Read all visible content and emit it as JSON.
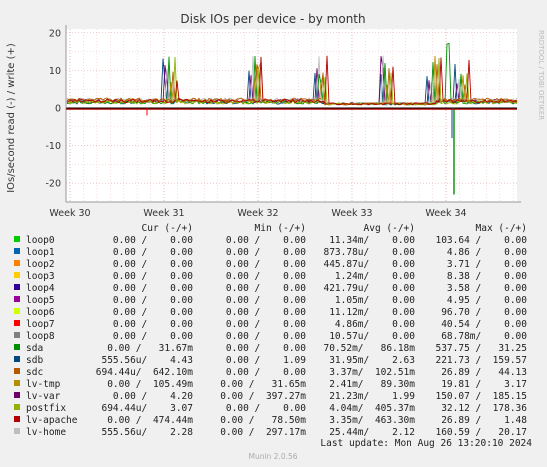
{
  "chart_data": {
    "type": "line",
    "title": "Disk IOs per device - by month",
    "ylabel": "IOs/second read (-) / write (+)",
    "side_label": "RRDTOOL / TOBI OETIKER",
    "ylim": [
      -25,
      21
    ],
    "yticks": [
      20,
      10,
      0,
      -10,
      -20
    ],
    "x_ticks": [
      "Week 30",
      "Week 31",
      "Week 32",
      "Week 33",
      "Week 34"
    ],
    "grid": true,
    "legend": {
      "headers": [
        "Cur (-/+)",
        "Min (-/+)",
        "Avg (-/+)",
        "Max (-/+)"
      ],
      "rows": [
        {
          "name": "loop0",
          "color": "#00cc00",
          "cur": "0.00 /    0.00",
          "min": "0.00 /    0.00",
          "avg": "11.34m/    0.00",
          "max": "103.64 /    0.00"
        },
        {
          "name": "loop1",
          "color": "#0066b3",
          "cur": "0.00 /    0.00",
          "min": "0.00 /    0.00",
          "avg": "873.78u/    0.00",
          "max": "4.86 /    0.00"
        },
        {
          "name": "loop2",
          "color": "#ff8000",
          "cur": "0.00 /    0.00",
          "min": "0.00 /    0.00",
          "avg": "445.87u/    0.00",
          "max": "3.71 /    0.00"
        },
        {
          "name": "loop3",
          "color": "#ffcc00",
          "cur": "0.00 /    0.00",
          "min": "0.00 /    0.00",
          "avg": "1.24m/    0.00",
          "max": "8.38 /    0.00"
        },
        {
          "name": "loop4",
          "color": "#330099",
          "cur": "0.00 /    0.00",
          "min": "0.00 /    0.00",
          "avg": "421.79u/    0.00",
          "max": "3.58 /    0.00"
        },
        {
          "name": "loop5",
          "color": "#990099",
          "cur": "0.00 /    0.00",
          "min": "0.00 /    0.00",
          "avg": "1.05m/    0.00",
          "max": "4.95 /    0.00"
        },
        {
          "name": "loop6",
          "color": "#ccff00",
          "cur": "0.00 /    0.00",
          "min": "0.00 /    0.00",
          "avg": "11.12m/    0.00",
          "max": "96.70 /    0.00"
        },
        {
          "name": "loop7",
          "color": "#ff0000",
          "cur": "0.00 /    0.00",
          "min": "0.00 /    0.00",
          "avg": "4.86m/    0.00",
          "max": "40.54 /    0.00"
        },
        {
          "name": "loop8",
          "color": "#808080",
          "cur": "0.00 /    0.00",
          "min": "0.00 /    0.00",
          "avg": "10.57u/    0.00",
          "max": "68.78m/    0.00"
        },
        {
          "name": "sda",
          "color": "#008f00",
          "cur": "0.00 /   31.67m",
          "min": "0.00 /    0.00",
          "avg": "70.52m/   86.18m",
          "max": "537.75 /   31.25"
        },
        {
          "name": "sdb",
          "color": "#00487d",
          "cur": "555.56u/    4.43",
          "min": "0.00 /    1.09",
          "avg": "31.95m/    2.63",
          "max": "221.73 /  159.57"
        },
        {
          "name": "sdc",
          "color": "#b35a00",
          "cur": "694.44u/  642.10m",
          "min": "0.00 /    0.00",
          "avg": "3.37m/  102.51m",
          "max": "26.89 /   44.13"
        },
        {
          "name": "lv-tmp",
          "color": "#b38f00",
          "cur": "0.00 /  105.49m",
          "min": "0.00 /   31.65m",
          "avg": "2.41m/   89.30m",
          "max": "19.81 /    3.17"
        },
        {
          "name": "lv-var",
          "color": "#6b006b",
          "cur": "0.00 /    4.20",
          "min": "0.00 /  397.27m",
          "avg": "21.23m/    1.99",
          "max": "150.07 /  185.15"
        },
        {
          "name": "postfix",
          "color": "#8fb300",
          "cur": "694.44u/    3.07",
          "min": "0.00 /    0.00",
          "avg": "4.04m/  405.37m",
          "max": "32.12 /  178.36"
        },
        {
          "name": "lv-apache",
          "color": "#b30000",
          "cur": "0.00 /  474.44m",
          "min": "0.00 /   78.50m",
          "avg": "3.35m/  463.30m",
          "max": "26.89 /    1.48"
        },
        {
          "name": "lv-home",
          "color": "#bebebe",
          "cur": "555.56u/    2.28",
          "min": "0.00 /  297.17m",
          "avg": "25.44m/    2.12",
          "max": "160.59 /   20.17"
        }
      ]
    },
    "last_update": "Last update: Mon Aug 26 13:20:10 2024",
    "footer": "Munin 2.0.56",
    "series_shape": {
      "baseline_write": [
        1.5,
        2.5
      ],
      "spike_weeks": [
        31.0,
        31.9,
        32.6,
        33.3,
        33.8,
        34.1
      ],
      "week34_read_dip": -23
    }
  }
}
